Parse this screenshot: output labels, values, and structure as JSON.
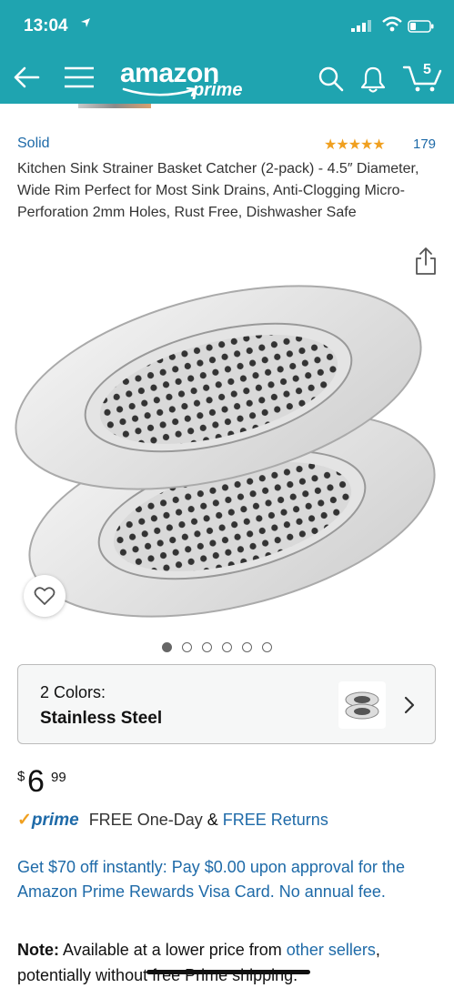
{
  "status_bar": {
    "time": "13:04"
  },
  "nav": {
    "logo_text": "amazon",
    "logo_sub": "prime",
    "cart_count": "5"
  },
  "product": {
    "brand": "Solid",
    "stars": "★★★★★",
    "rating_count": "179",
    "title": "Kitchen Sink Strainer Basket Catcher (2-pack) - 4.5″ Diameter, Wide Rim Perfect for Most Sink Drains, Anti-Clogging Micro-Perforation 2mm Holes, Rust Free, Dishwasher Safe",
    "image_count": 6,
    "image_index": 1
  },
  "variant": {
    "label": "2 Colors:",
    "value": "Stainless Steel"
  },
  "price": {
    "currency": "$",
    "whole": "6",
    "fraction": "99"
  },
  "delivery": {
    "prime_label": "prime",
    "free_delivery": "FREE One-Day",
    "ampersand": "&",
    "free_returns": "FREE Returns"
  },
  "promo": {
    "text": "Get $70 off instantly: Pay $0.00 upon approval for the Amazon Prime Rewards Visa Card. No annual fee."
  },
  "note": {
    "label": "Note:",
    "text_before": " Available at a lower price from ",
    "link": "other sellers",
    "text_after": ", potentially without free Prime shipping."
  },
  "colors": {
    "teal_header": "#1fa4b0",
    "link_blue": "#1e6aa8",
    "star_orange": "#f0a020"
  }
}
